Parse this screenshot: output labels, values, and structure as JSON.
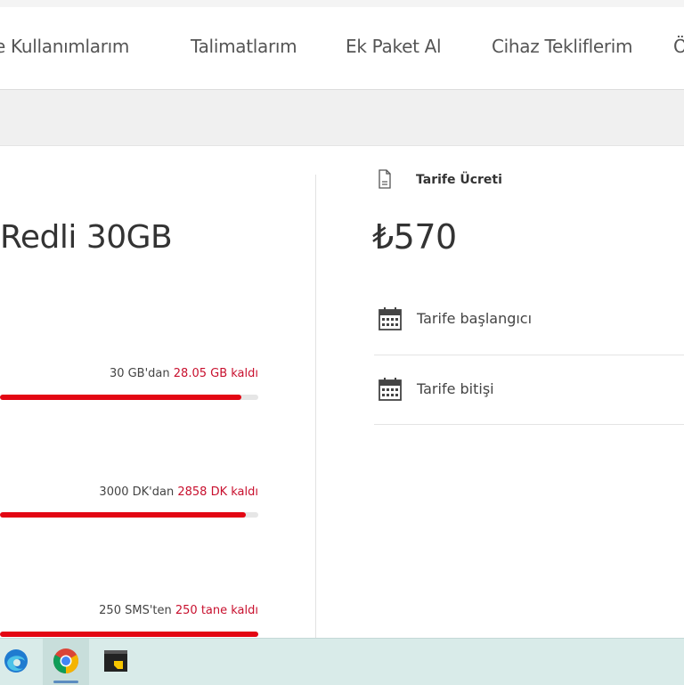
{
  "nav": {
    "items": [
      {
        "label": "e Kullanımlarım"
      },
      {
        "label": "Talimatlarım"
      },
      {
        "label": "Ek Paket Al"
      },
      {
        "label": "Cihaz Tekliflerim"
      }
    ],
    "overflow": "Ö"
  },
  "plan": {
    "name": "Redli 30GB"
  },
  "usage": [
    {
      "total": "30 GB'dan",
      "remaining": "28.05 GB kaldı",
      "fraction": 0.935
    },
    {
      "total": "3000 DK'dan",
      "remaining": "2858 DK kaldı",
      "fraction": 0.953
    },
    {
      "total": "250 SMS'ten",
      "remaining": "250 tane kaldı",
      "fraction": 1.0
    }
  ],
  "fee": {
    "label": "Tarife Ücreti",
    "value": "₺570"
  },
  "dates": [
    {
      "label": "Tarife başlangıcı"
    },
    {
      "label": "Tarife bitişi"
    }
  ],
  "taskbar": {
    "apps": [
      "edge-icon",
      "chrome-icon",
      "sticky-app-icon"
    ]
  },
  "colors": {
    "accent": "#e30613",
    "remaining_text": "#c8102e",
    "taskbar": "#d9ebe9"
  }
}
